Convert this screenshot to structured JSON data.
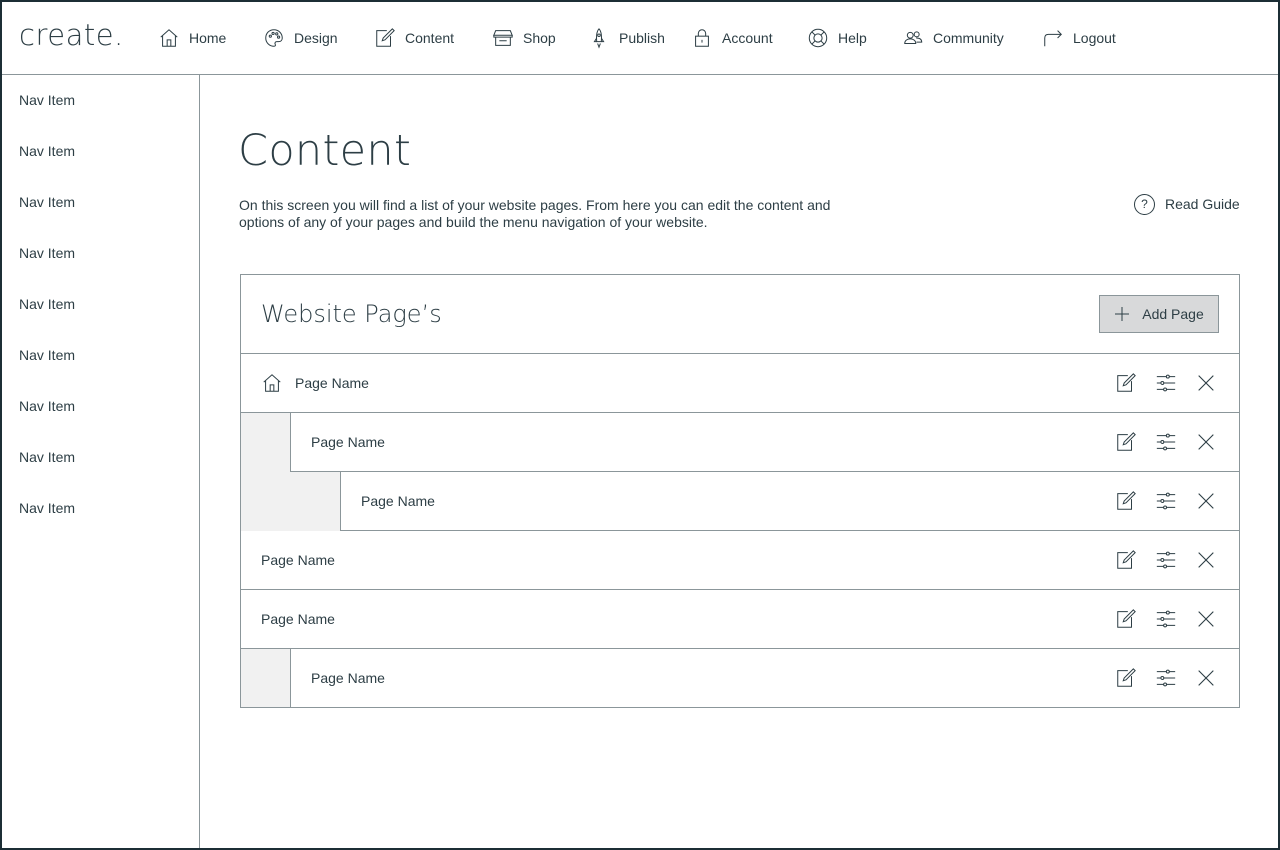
{
  "app": {
    "logo": "create."
  },
  "topnav": [
    {
      "label": "Home",
      "icon": "home-icon"
    },
    {
      "label": "Design",
      "icon": "palette-icon"
    },
    {
      "label": "Content",
      "icon": "edit-icon"
    },
    {
      "label": "Shop",
      "icon": "store-icon"
    },
    {
      "label": "Publish",
      "icon": "rocket-icon"
    },
    {
      "label": "Account",
      "icon": "lock-icon"
    },
    {
      "label": "Help",
      "icon": "lifebuoy-icon"
    },
    {
      "label": "Community",
      "icon": "users-icon"
    },
    {
      "label": "Logout",
      "icon": "logout-arrow-icon"
    }
  ],
  "sidebar": {
    "items": [
      {
        "label": "Nav Item"
      },
      {
        "label": "Nav Item"
      },
      {
        "label": "Nav Item"
      },
      {
        "label": "Nav Item"
      },
      {
        "label": "Nav Item"
      },
      {
        "label": "Nav Item"
      },
      {
        "label": "Nav Item"
      },
      {
        "label": "Nav Item"
      },
      {
        "label": "Nav Item"
      }
    ]
  },
  "main": {
    "title": "Content",
    "intro": "On this screen you will find a list of your website pages. From here you can edit the content and options of any of your pages and build the menu navigation of your website.",
    "guide_label": "Read Guide",
    "guide_icon_text": "?"
  },
  "pages_panel": {
    "title": "Website Page’s",
    "add_label": "Add Page",
    "rows": [
      {
        "name": "Page Name",
        "level": 0,
        "home": true
      },
      {
        "name": "Page Name",
        "level": 1,
        "home": false
      },
      {
        "name": "Page Name",
        "level": 2,
        "home": false
      },
      {
        "name": "Page Name",
        "level": 0,
        "home": false
      },
      {
        "name": "Page Name",
        "level": 0,
        "home": false
      },
      {
        "name": "Page Name",
        "level": 1,
        "home": false
      }
    ]
  }
}
